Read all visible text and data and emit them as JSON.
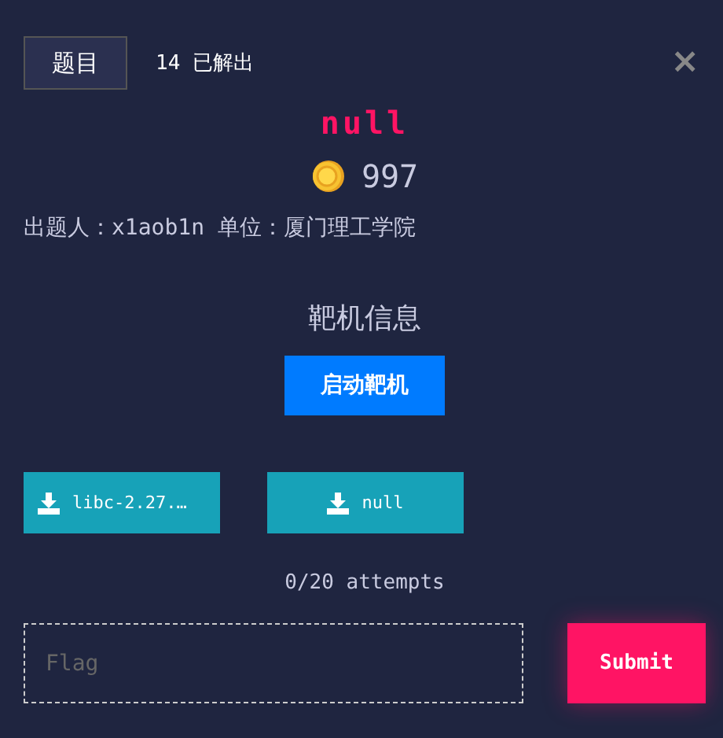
{
  "tab": {
    "label": "题目"
  },
  "solves": "14 已解出",
  "close": "×",
  "title": "null",
  "points": "997",
  "author_line": "出题人：x1aob1n 单位：厦门理工学院",
  "target_heading": "靶机信息",
  "start_button": "启动靶机",
  "downloads": [
    {
      "label": "libc-2.27.…"
    },
    {
      "label": "null"
    }
  ],
  "attempts": "0/20 attempts",
  "flag_field": {
    "placeholder": "Flag"
  },
  "submit_button": "Submit"
}
